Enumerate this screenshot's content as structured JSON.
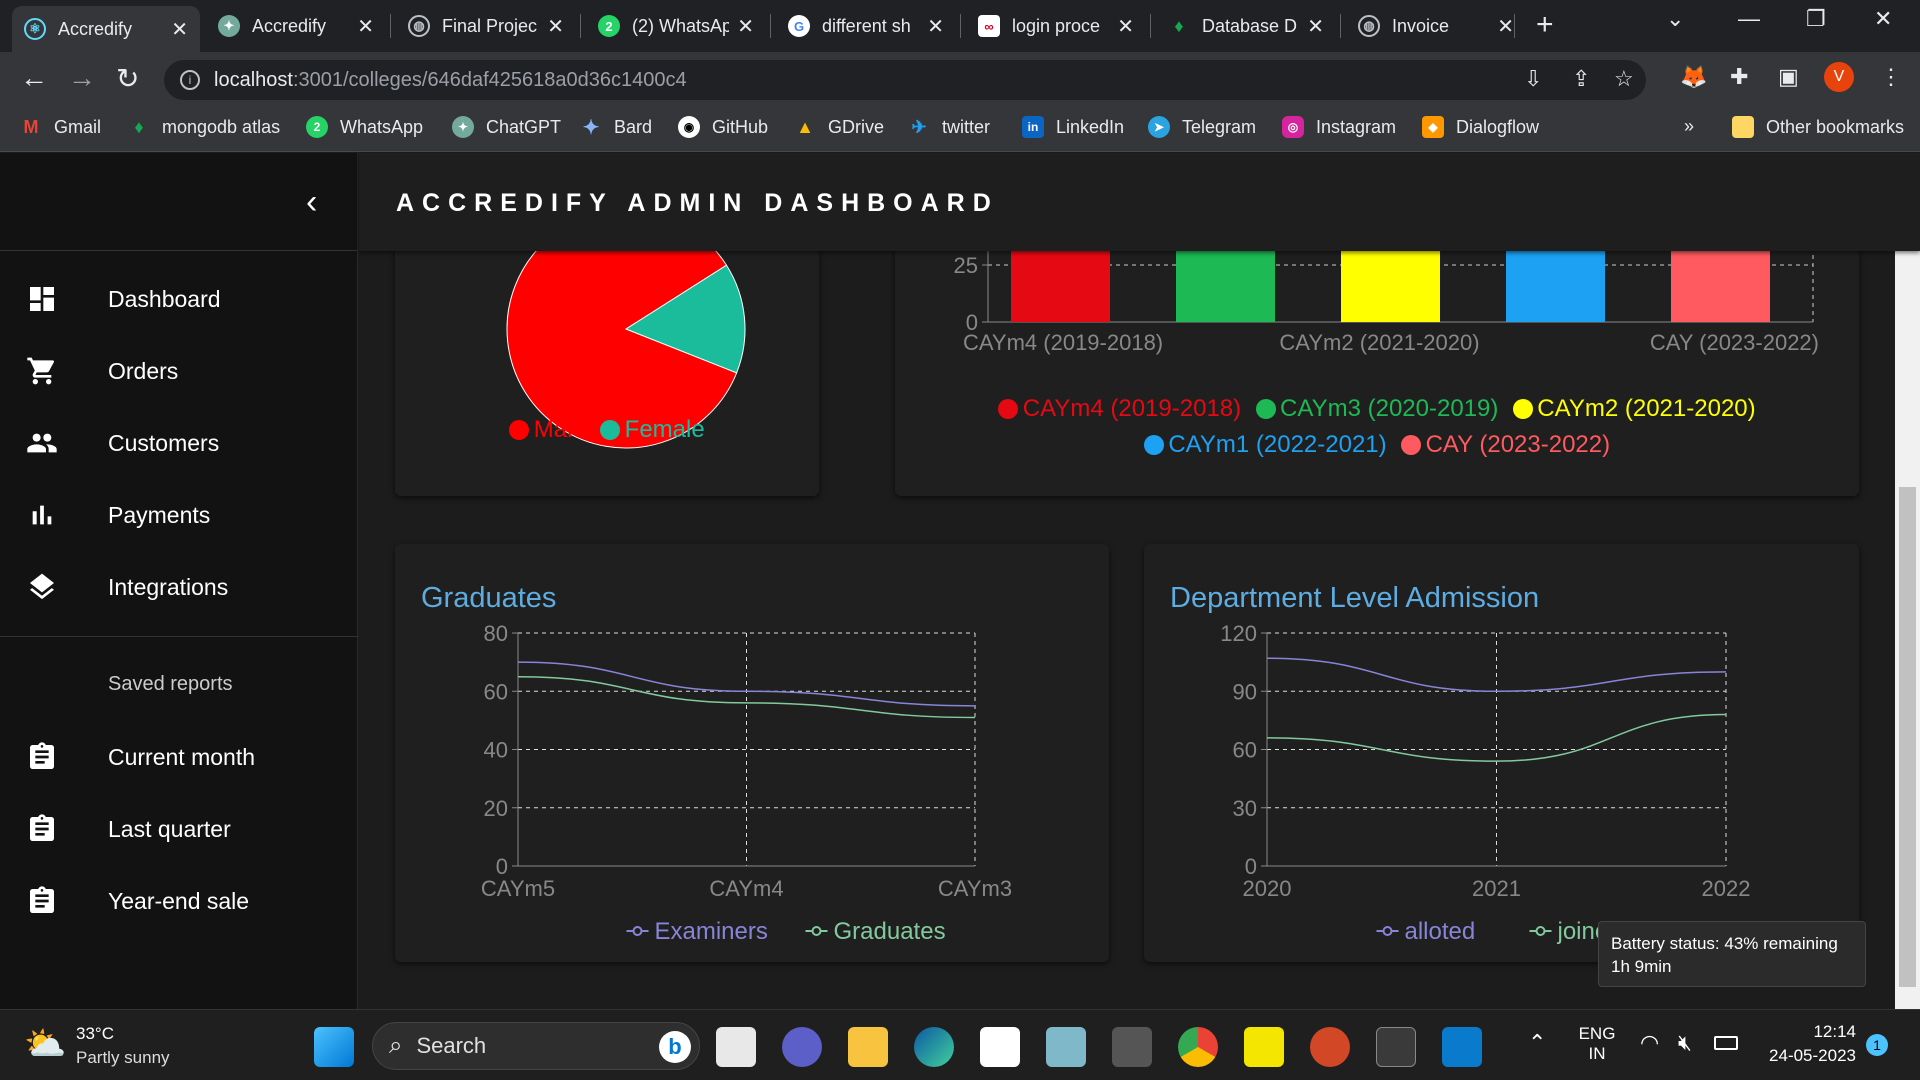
{
  "browser": {
    "tabs": [
      {
        "title": "Accredify",
        "active": true
      },
      {
        "title": "Accredify"
      },
      {
        "title": "Final Projec"
      },
      {
        "title": "(2) WhatsAp"
      },
      {
        "title": "different sh"
      },
      {
        "title": "login proce"
      },
      {
        "title": "Database D"
      },
      {
        "title": "Invoice"
      }
    ],
    "url_host": "localhost",
    "url_path": ":3001/colleges/646daf425618a0d36c1400c4",
    "profile_initial": "V",
    "bookmarks": [
      "Gmail",
      "mongodb atlas",
      "WhatsApp",
      "ChatGPT",
      "Bard",
      "GitHub",
      "GDrive",
      "twitter",
      "LinkedIn",
      "Telegram",
      "Instagram",
      "Dialogflow"
    ],
    "other_bookmarks": "Other bookmarks",
    "overflow": "»"
  },
  "app": {
    "title": "ACCREDIFY ADMIN DASHBOARD",
    "nav": [
      {
        "label": "Dashboard",
        "icon": "dashboard-icon"
      },
      {
        "label": "Orders",
        "icon": "cart-icon"
      },
      {
        "label": "Customers",
        "icon": "people-icon"
      },
      {
        "label": "Payments",
        "icon": "bar-chart-icon"
      },
      {
        "label": "Integrations",
        "icon": "layers-icon"
      }
    ],
    "saved_reports_label": "Saved reports",
    "reports": [
      {
        "label": "Current month",
        "icon": "clipboard-icon"
      },
      {
        "label": "Last quarter",
        "icon": "clipboard-icon"
      },
      {
        "label": "Year-end sale",
        "icon": "clipboard-icon"
      }
    ]
  },
  "colors": {
    "male": "#ff0000",
    "female": "#1abc9c",
    "accent_title": "#5dade2",
    "series_purple": "#8884d8",
    "series_green": "#82ca9d"
  },
  "chart_data": [
    {
      "type": "pie",
      "labels": [
        "Male",
        "Female"
      ],
      "colors": [
        "#ff0000",
        "#1abc9c"
      ],
      "values": [
        85,
        15
      ]
    },
    {
      "type": "bar",
      "categories": [
        "CAYm4 (2019-2018)",
        "CAYm3 (2020-2019)",
        "CAYm2 (2021-2020)",
        "CAYm1 (2022-2021)",
        "CAY (2023-2022)"
      ],
      "x_tick_labels": [
        "CAYm4 (2019-2018)",
        "CAYm2 (2021-2020)",
        "CAY (2023-2022)"
      ],
      "colors": [
        "#e50914",
        "#1db954",
        "#ffff00",
        "#1da1f2",
        "#ff5a5f"
      ],
      "y_ticks": [
        0,
        25
      ],
      "legend": [
        "CAYm4 (2019-2018)",
        "CAYm3 (2020-2019)",
        "CAYm2 (2021-2020)",
        "CAYm1 (2022-2021)",
        "CAY (2023-2022)"
      ]
    },
    {
      "type": "line",
      "title": "Graduates",
      "categories": [
        "CAYm5",
        "CAYm4",
        "CAYm3"
      ],
      "ylim": [
        0,
        80
      ],
      "y_ticks": [
        0,
        20,
        40,
        60,
        80
      ],
      "series": [
        {
          "name": "Examiners",
          "values": [
            70,
            60,
            55
          ],
          "color": "#8884d8"
        },
        {
          "name": "Graduates",
          "values": [
            65,
            56,
            51
          ],
          "color": "#82ca9d"
        }
      ],
      "grid": true
    },
    {
      "type": "line",
      "title": "Department Level Admission",
      "categories": [
        "2020",
        "2021",
        "2022"
      ],
      "ylim": [
        0,
        120
      ],
      "y_ticks": [
        0,
        30,
        60,
        90,
        120
      ],
      "series": [
        {
          "name": "alloted",
          "values": [
            107,
            90,
            100
          ],
          "color": "#8884d8"
        },
        {
          "name": "joined",
          "values": [
            66,
            54,
            78
          ],
          "color": "#82ca9d"
        }
      ],
      "grid": true
    }
  ],
  "tooltip": {
    "line1": "Battery status: 43% remaining",
    "line2": "1h 9min"
  },
  "taskbar": {
    "weather_temp": "33°C",
    "weather_desc": "Partly sunny",
    "search_placeholder": "Search",
    "lang_line1": "ENG",
    "lang_line2": "IN",
    "time": "12:14",
    "date": "24-05-2023",
    "notification_count": "1"
  }
}
